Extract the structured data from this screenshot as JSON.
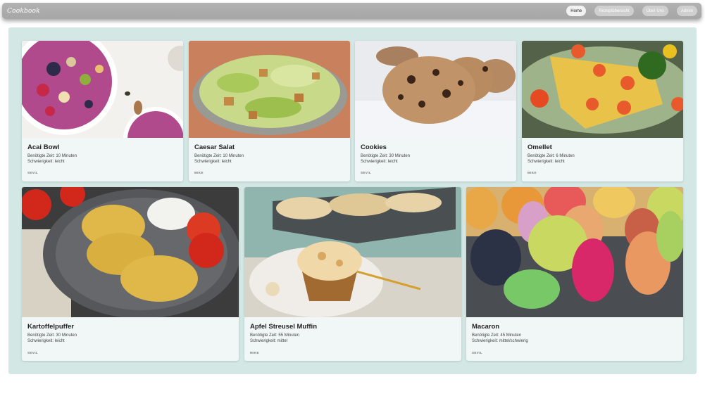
{
  "navbar": {
    "brand": "Cookbook",
    "links": [
      "Home",
      "Rezeptübersicht",
      "Über Uns",
      "Admin"
    ]
  },
  "recipes": [
    {
      "title": "Acai Bowl",
      "time": "Benötigte Zeit: 10 Minuten",
      "difficulty": "Schwierigkeit: leicht",
      "author": "SEVIL"
    },
    {
      "title": "Caesar Salat",
      "time": "Benötigte Zeit: 10 Minuten",
      "difficulty": "Schwierigkeit: leicht",
      "author": "MIKE"
    },
    {
      "title": "Cookies",
      "time": "Benötigte Zeit: 30 Minuten",
      "difficulty": "Schwierigkeit: leicht",
      "author": "SEVIL"
    },
    {
      "title": "Omellet",
      "time": "Benötigte Zeit: 6 Minuten",
      "difficulty": "Schwierigkeit: leicht",
      "author": "MIKE"
    },
    {
      "title": "Kartoffelpuffer",
      "time": "Benötigte Zeit: 30 Minuten",
      "difficulty": "Schwierigkeit: leicht",
      "author": "SEVIL"
    },
    {
      "title": "Apfel Streusel Muffin",
      "time": "Benötigte Zeit: 55 Minuten",
      "difficulty": "Schwierigkeit: mittel",
      "author": "MIKE"
    },
    {
      "title": "Macaron",
      "time": "Benötigte Zeit: 45 Minuten",
      "difficulty": "Schwierigkeit: mittel/schwierig",
      "author": "SEVIL"
    }
  ]
}
